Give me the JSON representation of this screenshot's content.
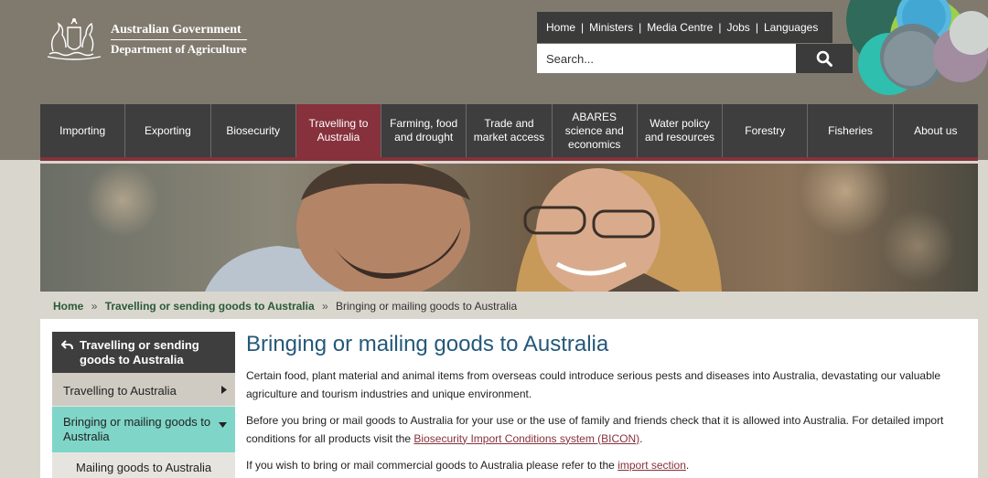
{
  "header": {
    "logo_line1": "Australian Government",
    "logo_line2": "Department of Agriculture",
    "utility_links": [
      "Home",
      "Ministers",
      "Media Centre",
      "Jobs",
      "Languages"
    ],
    "search_placeholder": "Search..."
  },
  "nav": {
    "items": [
      {
        "label": "Importing"
      },
      {
        "label": "Exporting"
      },
      {
        "label": "Biosecurity"
      },
      {
        "label": "Travelling to Australia"
      },
      {
        "label": "Farming, food and drought"
      },
      {
        "label": "Trade and market access"
      },
      {
        "label": "ABARES science and economics"
      },
      {
        "label": "Water policy and resources"
      },
      {
        "label": "Forestry"
      },
      {
        "label": "Fisheries"
      },
      {
        "label": "About us"
      }
    ],
    "active_index": 3
  },
  "breadcrumb": {
    "home": "Home",
    "parent": "Travelling or sending goods to Australia",
    "current": "Bringing or mailing goods to Australia",
    "separator": "»"
  },
  "sidebar": {
    "heading": "Travelling or sending goods to Australia",
    "items": [
      {
        "label": "Travelling to Australia"
      },
      {
        "label": "Bringing or mailing goods to Australia"
      }
    ],
    "sub_item": "Mailing goods to Australia"
  },
  "main": {
    "title": "Bringing or mailing goods to Australia",
    "para1": "Certain food, plant material and animal items from overseas could introduce serious pests and diseases into Australia, devastating our valuable agriculture and tourism industries and unique environment.",
    "para2_before": "Before you bring or mail goods to Australia for your use or the use of family and friends check that it is allowed into Australia. For detailed import conditions for all products visit the ",
    "para2_link": "Biosecurity Import Conditions system (BICON)",
    "para2_after": ".",
    "para3_before": "If you wish to bring or mail commercial goods to Australia please refer to the ",
    "para3_link": "import section",
    "para3_after": "."
  },
  "colors": {
    "header_bg": "#807a6e",
    "nav_bg": "#3e3e3e",
    "accent_maroon": "#86313c",
    "sidebar_active": "#7fd6c8",
    "title_blue": "#24587a"
  }
}
